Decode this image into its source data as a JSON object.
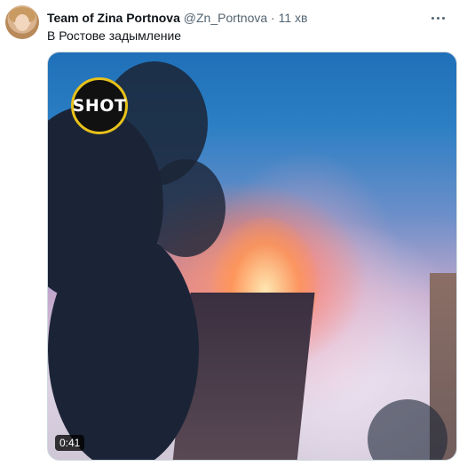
{
  "tweet": {
    "author_name": "Team of Zina Portnova",
    "author_handle": "@Zn_Portnova",
    "separator": "·",
    "time": "11 хв",
    "text": "В Ростове задымление"
  },
  "media": {
    "type": "video",
    "logo_text": "SHOT",
    "duration": "0:41"
  },
  "colors": {
    "name": "#0f1419",
    "secondary": "#536471",
    "logo_ring": "#e8c21a"
  },
  "icons": {
    "more": "more-horizontal-icon"
  }
}
